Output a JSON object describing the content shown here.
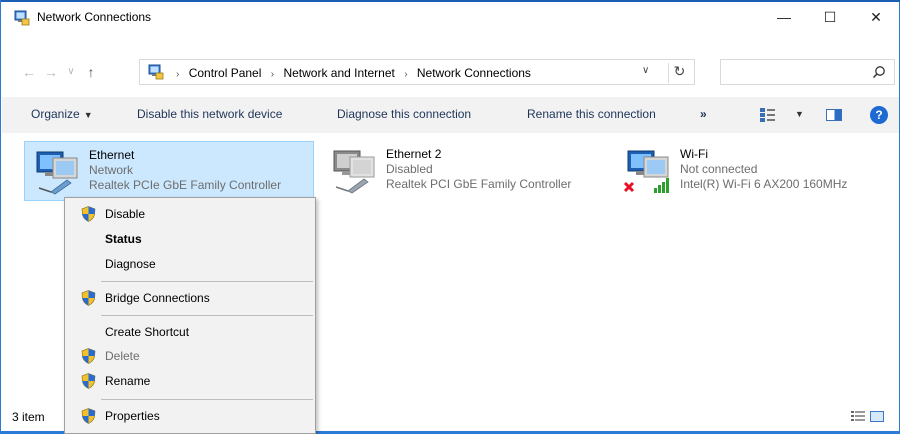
{
  "window": {
    "title": "Network Connections",
    "controls": {
      "minimize": "—",
      "maximize": "☐",
      "close": "✕"
    }
  },
  "address": {
    "crumbs": [
      "Control Panel",
      "Network and Internet",
      "Network Connections"
    ],
    "search_placeholder": ""
  },
  "commands": {
    "organize": "Organize",
    "disable": "Disable this network device",
    "diagnose": "Diagnose this connection",
    "rename": "Rename this connection",
    "more": "»"
  },
  "connections": [
    {
      "name": "Ethernet",
      "status": "Network",
      "device": "Realtek PCIe GbE Family Controller",
      "selected": true
    },
    {
      "name": "Ethernet 2",
      "status": "Disabled",
      "device": "Realtek PCI GbE Family Controller",
      "selected": false
    },
    {
      "name": "Wi-Fi",
      "status": "Not connected",
      "device": "Intel(R) Wi-Fi 6 AX200 160MHz",
      "selected": false
    }
  ],
  "status_bar": {
    "count_text": "3 item"
  },
  "context_menu": {
    "disable": "Disable",
    "status": "Status",
    "diagnose": "Diagnose",
    "bridge": "Bridge Connections",
    "shortcut": "Create Shortcut",
    "delete": "Delete",
    "rename": "Rename",
    "properties": "Properties"
  },
  "colors": {
    "accent": "#1f6ad2",
    "selection": "#cce8ff",
    "command_text": "#1e3559",
    "error_red": "#e81123"
  },
  "icons": {
    "app": "network-connections-icon",
    "search": "search-icon",
    "refresh": "refresh-icon",
    "shield": "uac-shield-icon",
    "help": "help-icon"
  }
}
